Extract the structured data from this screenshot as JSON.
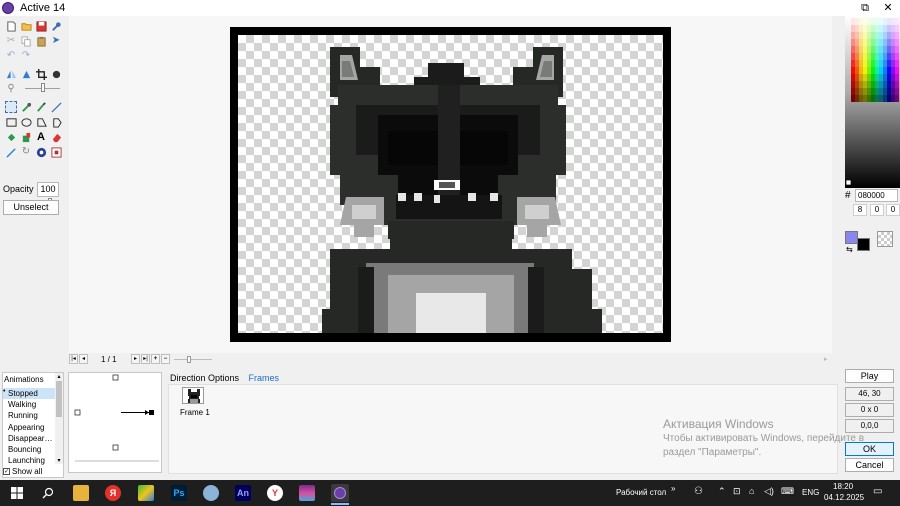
{
  "window": {
    "title": "Active 14",
    "minimize_glyph": "—",
    "restore_glyph": "⧉",
    "close_glyph": "✕"
  },
  "toolbar": {
    "tool_icons": [
      "new-file-icon",
      "open-folder-icon",
      "save-icon",
      "wrench-icon",
      "cut-icon",
      "copy-icon",
      "paste-icon",
      "redirect-icon",
      "undo-icon",
      "redo-icon",
      "flip-icon",
      "rotate-icon",
      "crop-icon",
      "resize-icon",
      "zoom-icon",
      "rect-select-icon",
      "eyedropper-icon",
      "brush-icon",
      "line-icon",
      "rectangle-icon",
      "ellipse-icon",
      "polygon-icon",
      "lasso-icon",
      "fill-bucket-icon",
      "color-replace-icon",
      "text-icon",
      "eraser-icon",
      "pen-icon",
      "rotate-pen-icon",
      "circle-tool-icon",
      "square-tool-icon"
    ],
    "opacity_label": "Opacity",
    "opacity_value": "100",
    "unselect_label": "Unselect"
  },
  "navigator": {
    "page": "1 / 1",
    "first": "|◂",
    "prev": "◂",
    "next": "▸",
    "last": "▸|",
    "add": "+",
    "remove": "−"
  },
  "color": {
    "hash": "#",
    "hex": "080000",
    "r": "8",
    "g": "0",
    "b": "0",
    "primary": "#8a86f0",
    "secondary": "#000000"
  },
  "animations": {
    "title": "Animations",
    "items": [
      "Stopped",
      "Walking",
      "Running",
      "Appearing",
      "Disappear…",
      "Bouncing",
      "Launching"
    ],
    "selected_index": 0,
    "show_all": "Show all",
    "show_all_checked": true
  },
  "direction_tabs": [
    "Direction Options",
    "Frames"
  ],
  "frames": [
    {
      "label": "Frame 1"
    }
  ],
  "right_panel": {
    "play": "Play",
    "hotspot": "46, 30",
    "size": "0 x 0",
    "action": "0,0,0",
    "ok": "OK",
    "cancel": "Cancel"
  },
  "watermark": {
    "line1": "Активация Windows",
    "line2": "Чтобы активировать Windows, перейдите в",
    "line3": "раздел \"Параметры\"."
  },
  "taskbar": {
    "apps": [
      "start-icon",
      "search-icon",
      "file-explorer-icon",
      "yandex-icon",
      "bluestacks-icon",
      "photoshop-icon",
      "paint-icon",
      "animate-icon",
      "yandex-browser-icon",
      "winrar-icon",
      "clickteam-icon"
    ],
    "photoshop_text": "Ps",
    "animate_text": "An",
    "yandex_text": "Я",
    "desktop_label": "Рабочий стол",
    "desktop_chevron": "»",
    "lang": "ENG",
    "time": "18:20",
    "date": "04.12.2025"
  }
}
